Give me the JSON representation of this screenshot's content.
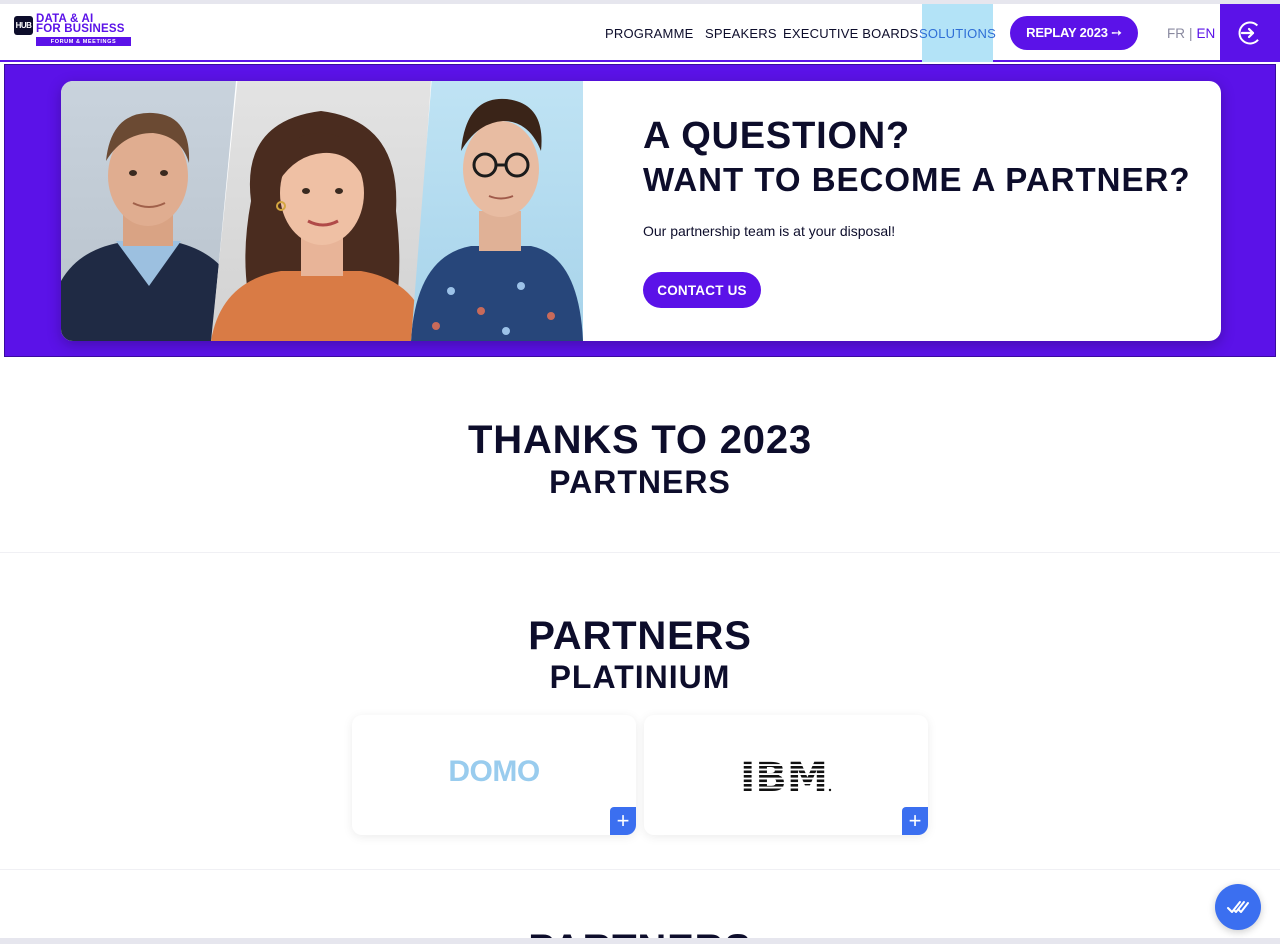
{
  "brand": {
    "badge": "HUB",
    "line1": "DATA & AI",
    "line2": "FOR BUSINESS",
    "line3": "FORUM & MEETINGS",
    "accent": "#5b12e8"
  },
  "nav": {
    "items": [
      {
        "label": "PROGRAMME"
      },
      {
        "label": "SPEAKERS"
      },
      {
        "label": "EXECUTIVE BOARDS"
      },
      {
        "label": "SOLUTIONS",
        "active": true
      }
    ],
    "cta": "REPLAY 2023 ➙",
    "lang_fr": "FR",
    "lang_sep": "|",
    "lang_en": "EN",
    "login_icon": "login-arrow-icon"
  },
  "hero": {
    "title": "A QUESTION?",
    "subtitle": "WANT TO BECOME A PARTNER?",
    "text": "Our partnership team is at your disposal!",
    "button": "CONTACT US"
  },
  "thanks": {
    "title": "THANKS TO 2023",
    "subtitle": "PARTNERS"
  },
  "partners": {
    "title": "PARTNERS",
    "subtitle": "PLATINIUM",
    "cards": [
      {
        "name": "DOMO",
        "expand_icon": "plus-icon"
      },
      {
        "name": "IBM",
        "expand_icon": "plus-icon"
      }
    ]
  },
  "next_section": {
    "title": "PARTNERS"
  },
  "chat": {
    "icon": "chat-icon"
  }
}
